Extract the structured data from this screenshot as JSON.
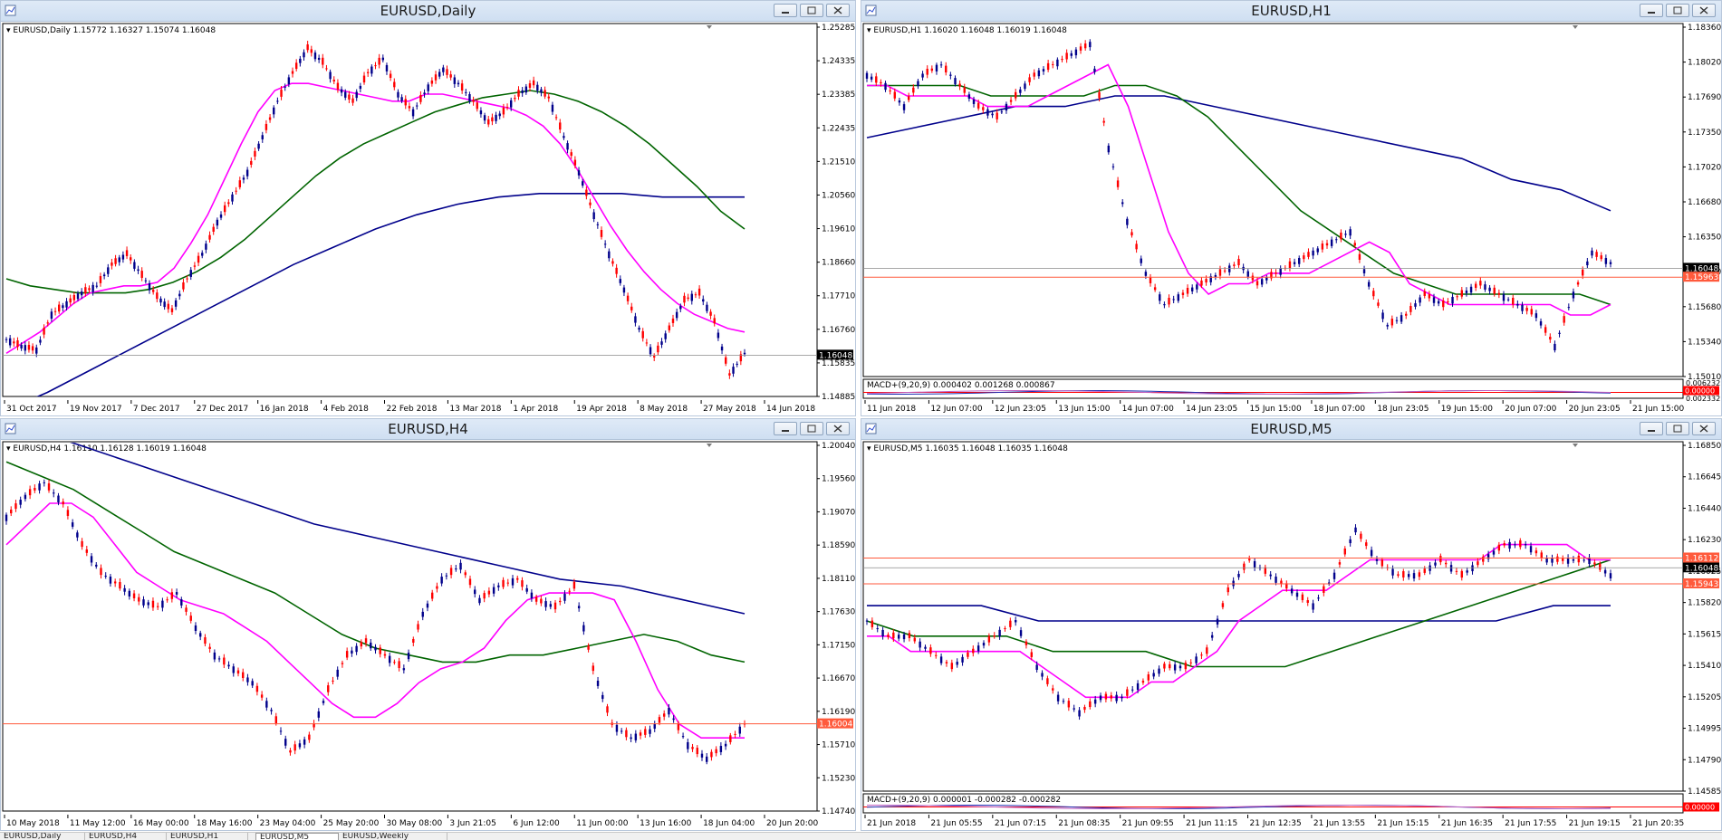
{
  "colors": {
    "candle": "#00008b",
    "bear": "#ff0000",
    "ma_fast": "#ff00ff",
    "ma_mid": "#006400",
    "ma_slow": "#00008b",
    "price_line": "#ff5a3c"
  },
  "windows": [
    {
      "id": "daily",
      "title": "EURUSD,Daily",
      "info": "EURUSD,Daily  1.15772 1.16327 1.15074 1.16048",
      "price_labels": [
        "1.25285",
        "1.24335",
        "1.23385",
        "1.22435",
        "1.21510",
        "1.20560",
        "1.19610",
        "1.18660",
        "1.17710",
        "1.16760",
        "1.15835",
        "1.14885"
      ],
      "price_min": 1.14885,
      "price_max": 1.25285,
      "current_price": "1.16048",
      "red_price": "",
      "time_labels": [
        "31 Oct 2017",
        "19 Nov 2017",
        "7 Dec 2017",
        "27 Dec 2017",
        "16 Jan 2018",
        "4 Feb 2018",
        "22 Feb 2018",
        "13 Mar 2018",
        "1 Apr 2018",
        "19 Apr 2018",
        "8 May 2018",
        "27 May 2018",
        "14 Jun 2018"
      ],
      "macd_info": "",
      "series": {
        "price": [
          1.165,
          1.163,
          1.162,
          1.172,
          1.175,
          1.178,
          1.18,
          1.186,
          1.189,
          1.183,
          1.177,
          1.173,
          1.182,
          1.189,
          1.198,
          1.205,
          1.212,
          1.222,
          1.232,
          1.24,
          1.247,
          1.243,
          1.236,
          1.232,
          1.24,
          1.244,
          1.234,
          1.229,
          1.236,
          1.241,
          1.237,
          1.232,
          1.226,
          1.229,
          1.234,
          1.237,
          1.233,
          1.222,
          1.212,
          1.2,
          1.189,
          1.179,
          1.168,
          1.16,
          1.168,
          1.176,
          1.178,
          1.17,
          1.155,
          1.161
        ],
        "ma_fast": [
          1.161,
          1.164,
          1.167,
          1.171,
          1.175,
          1.178,
          1.179,
          1.18,
          1.18,
          1.181,
          1.185,
          1.192,
          1.2,
          1.21,
          1.22,
          1.229,
          1.235,
          1.237,
          1.237,
          1.236,
          1.235,
          1.234,
          1.233,
          1.232,
          1.232,
          1.234,
          1.234,
          1.233,
          1.232,
          1.231,
          1.23,
          1.228,
          1.225,
          1.22,
          1.213,
          1.205,
          1.197,
          1.19,
          1.184,
          1.179,
          1.175,
          1.172,
          1.17,
          1.168,
          1.167
        ],
        "ma_mid": [
          1.182,
          1.18,
          1.179,
          1.178,
          1.178,
          1.178,
          1.179,
          1.181,
          1.184,
          1.188,
          1.193,
          1.199,
          1.205,
          1.211,
          1.216,
          1.22,
          1.223,
          1.226,
          1.229,
          1.231,
          1.233,
          1.234,
          1.235,
          1.234,
          1.232,
          1.229,
          1.225,
          1.22,
          1.214,
          1.208,
          1.201,
          1.196
        ],
        "ma_slow": [
          1.145,
          1.15,
          1.156,
          1.162,
          1.168,
          1.174,
          1.18,
          1.186,
          1.191,
          1.196,
          1.2,
          1.203,
          1.205,
          1.206,
          1.206,
          1.206,
          1.205,
          1.205,
          1.205
        ]
      }
    },
    {
      "id": "h1",
      "title": "EURUSD,H1",
      "info": "EURUSD,H1  1.16020 1.16048 1.16019 1.16048",
      "price_labels": [
        "1.18360",
        "1.18020",
        "1.17690",
        "1.17350",
        "1.17020",
        "1.16680",
        "1.16350",
        "1.16010",
        "1.15680",
        "1.15340",
        "1.15010"
      ],
      "price_min": 1.1501,
      "price_max": 1.1836,
      "current_price": "1.16048",
      "red_price": "1.15963",
      "time_labels": [
        "11 Jun 2018",
        "12 Jun 07:00",
        "12 Jun 23:05",
        "13 Jun 15:00",
        "14 Jun 07:00",
        "14 Jun 23:05",
        "15 Jun 15:00",
        "18 Jun 07:00",
        "18 Jun 23:05",
        "19 Jun 15:00",
        "20 Jun 07:00",
        "20 Jun 23:05",
        "21 Jun 15:00"
      ],
      "macd_info": "MACD+(9,20,9) 0.000402 0.001268 0.000867",
      "macd_labels": [
        "0.006232",
        "0.00000",
        "0.002332"
      ],
      "series": {
        "price": [
          1.179,
          1.178,
          1.176,
          1.179,
          1.18,
          1.178,
          1.176,
          1.175,
          1.177,
          1.179,
          1.18,
          1.181,
          1.182,
          1.172,
          1.165,
          1.16,
          1.157,
          1.158,
          1.159,
          1.16,
          1.161,
          1.159,
          1.16,
          1.161,
          1.162,
          1.163,
          1.164,
          1.159,
          1.155,
          1.156,
          1.158,
          1.157,
          1.158,
          1.159,
          1.158,
          1.157,
          1.156,
          1.153,
          1.158,
          1.162,
          1.161
        ],
        "ma_fast": [
          1.178,
          1.178,
          1.177,
          1.177,
          1.177,
          1.177,
          1.176,
          1.176,
          1.176,
          1.177,
          1.178,
          1.179,
          1.18,
          1.176,
          1.17,
          1.164,
          1.16,
          1.158,
          1.159,
          1.159,
          1.16,
          1.16,
          1.16,
          1.161,
          1.162,
          1.163,
          1.162,
          1.159,
          1.158,
          1.157,
          1.157,
          1.157,
          1.157,
          1.157,
          1.157,
          1.156,
          1.156,
          1.157
        ],
        "ma_mid": [
          1.178,
          1.178,
          1.178,
          1.178,
          1.177,
          1.177,
          1.177,
          1.177,
          1.178,
          1.178,
          1.177,
          1.175,
          1.172,
          1.169,
          1.166,
          1.164,
          1.162,
          1.16,
          1.159,
          1.158,
          1.158,
          1.158,
          1.158,
          1.158,
          1.157
        ],
        "ma_slow": [
          1.173,
          1.174,
          1.175,
          1.176,
          1.176,
          1.177,
          1.177,
          1.176,
          1.175,
          1.174,
          1.173,
          1.172,
          1.171,
          1.169,
          1.168,
          1.166
        ]
      }
    },
    {
      "id": "h4",
      "title": "EURUSD,H4",
      "info": "EURUSD,H4  1.16110 1.16128 1.16019 1.16048",
      "price_labels": [
        "1.20040",
        "1.19560",
        "1.19070",
        "1.18590",
        "1.18110",
        "1.17630",
        "1.17150",
        "1.16670",
        "1.16190",
        "1.15710",
        "1.15230",
        "1.14740"
      ],
      "price_min": 1.1474,
      "price_max": 1.2004,
      "current_price": "",
      "red_price": "1.16004",
      "time_labels": [
        "10 May 2018",
        "11 May 12:00",
        "16 May 00:00",
        "18 May 16:00",
        "23 May 04:00",
        "25 May 20:00",
        "30 May 08:00",
        "3 Jun 21:05",
        "6 Jun 12:00",
        "11 Jun 00:00",
        "13 Jun 16:00",
        "18 Jun 04:00",
        "20 Jun 20:00"
      ],
      "macd_info": "",
      "series": {
        "price": [
          1.19,
          1.193,
          1.195,
          1.192,
          1.186,
          1.182,
          1.18,
          1.178,
          1.177,
          1.179,
          1.174,
          1.17,
          1.168,
          1.166,
          1.162,
          1.156,
          1.158,
          1.165,
          1.17,
          1.172,
          1.17,
          1.168,
          1.176,
          1.181,
          1.183,
          1.178,
          1.18,
          1.181,
          1.178,
          1.177,
          1.18,
          1.168,
          1.16,
          1.158,
          1.159,
          1.162,
          1.157,
          1.155,
          1.157,
          1.16
        ],
        "ma_fast": [
          1.186,
          1.189,
          1.192,
          1.192,
          1.19,
          1.186,
          1.182,
          1.18,
          1.178,
          1.177,
          1.176,
          1.174,
          1.172,
          1.169,
          1.166,
          1.163,
          1.161,
          1.161,
          1.163,
          1.166,
          1.168,
          1.169,
          1.171,
          1.175,
          1.178,
          1.179,
          1.179,
          1.179,
          1.178,
          1.172,
          1.165,
          1.16,
          1.158,
          1.158,
          1.158
        ],
        "ma_mid": [
          1.198,
          1.196,
          1.194,
          1.191,
          1.188,
          1.185,
          1.183,
          1.181,
          1.179,
          1.176,
          1.173,
          1.171,
          1.17,
          1.169,
          1.169,
          1.17,
          1.17,
          1.171,
          1.172,
          1.173,
          1.172,
          1.17,
          1.169
        ],
        "ma_slow": [
          1.204,
          1.201,
          1.198,
          1.195,
          1.192,
          1.189,
          1.187,
          1.185,
          1.183,
          1.181,
          1.18,
          1.178,
          1.176
        ]
      }
    },
    {
      "id": "m5",
      "title": "EURUSD,M5",
      "info": "EURUSD,M5  1.16035 1.16048 1.16035 1.16048",
      "price_labels": [
        "1.16850",
        "1.16645",
        "1.16440",
        "1.16230",
        "1.16025",
        "1.15820",
        "1.15615",
        "1.15410",
        "1.15205",
        "1.14995",
        "1.14790",
        "1.14585"
      ],
      "price_min": 1.14585,
      "price_max": 1.1685,
      "current_price": "1.16048",
      "red_price": "1.16112",
      "red_price2": "1.15943",
      "time_labels": [
        "21 Jun 2018",
        "21 Jun 05:55",
        "21 Jun 07:15",
        "21 Jun 08:35",
        "21 Jun 09:55",
        "21 Jun 11:15",
        "21 Jun 12:35",
        "21 Jun 13:55",
        "21 Jun 15:15",
        "21 Jun 16:35",
        "21 Jun 17:55",
        "21 Jun 19:15",
        "21 Jun 20:35"
      ],
      "macd_info": "MACD+(9,20,9) 0.000001 -0.000282 -0.000282",
      "macd_labels": [
        "0.00000"
      ],
      "series": {
        "price": [
          1.157,
          1.156,
          1.156,
          1.155,
          1.154,
          1.155,
          1.156,
          1.157,
          1.154,
          1.152,
          1.151,
          1.152,
          1.152,
          1.153,
          1.154,
          1.154,
          1.155,
          1.159,
          1.161,
          1.16,
          1.159,
          1.158,
          1.16,
          1.163,
          1.161,
          1.16,
          1.16,
          1.161,
          1.16,
          1.161,
          1.162,
          1.162,
          1.161,
          1.161,
          1.161,
          1.16
        ],
        "ma_fast": [
          1.156,
          1.156,
          1.155,
          1.155,
          1.155,
          1.155,
          1.155,
          1.155,
          1.154,
          1.153,
          1.152,
          1.152,
          1.152,
          1.153,
          1.153,
          1.154,
          1.155,
          1.157,
          1.158,
          1.159,
          1.159,
          1.159,
          1.16,
          1.161,
          1.161,
          1.161,
          1.161,
          1.161,
          1.161,
          1.162,
          1.162,
          1.162,
          1.162,
          1.161,
          1.161
        ],
        "ma_mid": [
          1.157,
          1.156,
          1.156,
          1.156,
          1.155,
          1.155,
          1.155,
          1.154,
          1.154,
          1.154,
          1.155,
          1.156,
          1.157,
          1.158,
          1.159,
          1.16,
          1.161
        ],
        "ma_slow": [
          1.158,
          1.158,
          1.158,
          1.157,
          1.157,
          1.157,
          1.157,
          1.157,
          1.157,
          1.157,
          1.157,
          1.157,
          1.158,
          1.158
        ]
      }
    }
  ],
  "tabs": [
    {
      "label": "EURUSD,Daily",
      "active": false
    },
    {
      "label": "EURUSD,H4",
      "active": false
    },
    {
      "label": "EURUSD,H1",
      "active": false
    },
    {
      "label": "EURUSD,M5",
      "active": true
    },
    {
      "label": "EURUSD,Weekly",
      "active": false
    }
  ]
}
